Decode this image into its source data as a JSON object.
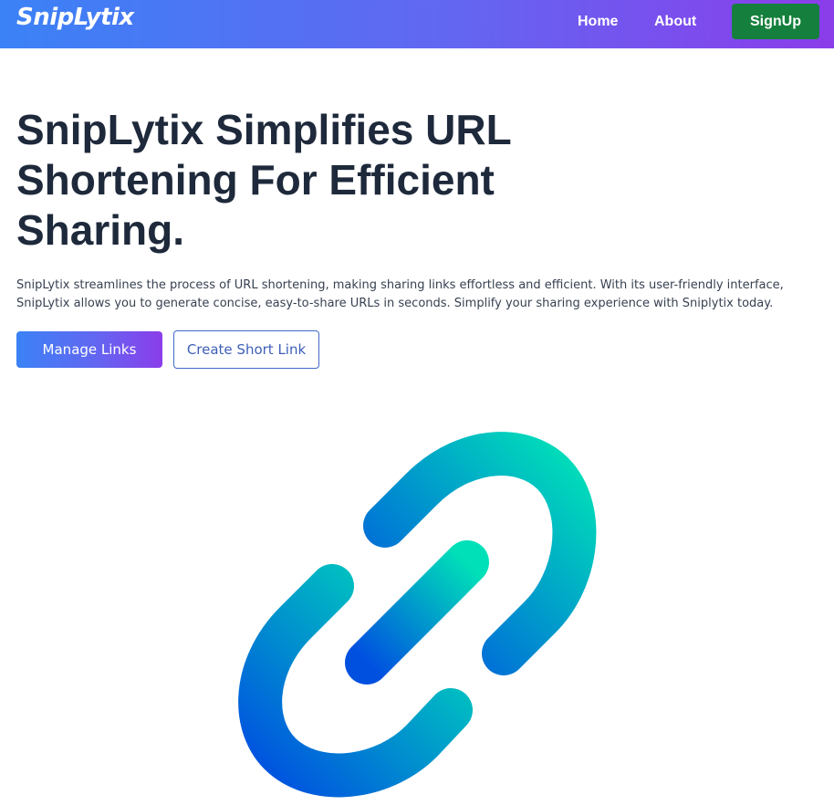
{
  "navbar": {
    "brand": "SnipLytix",
    "links": [
      {
        "label": "Home"
      },
      {
        "label": "About"
      }
    ],
    "signup_label": "SignUp",
    "colors": {
      "gradient_start": "#3b82f6",
      "gradient_end": "#8b3dea",
      "signup_bg": "#15803d"
    }
  },
  "hero": {
    "title": "SnipLytix Simplifies URL Shortening For Efficient Sharing.",
    "description": "SnipLytix streamlines the process of URL shortening, making sharing links effortless and efficient. With its user-friendly interface, SnipLytix allows you to generate concise, easy-to-share URLs in seconds. Simplify your sharing experience with Sniplytix today.",
    "primary_button": "Manage Links",
    "secondary_button": "Create Short Link"
  },
  "illustration": {
    "icon": "chain-link-icon",
    "colors": {
      "gradient_top": "#00e0b8",
      "gradient_bottom": "#0050e0"
    }
  }
}
